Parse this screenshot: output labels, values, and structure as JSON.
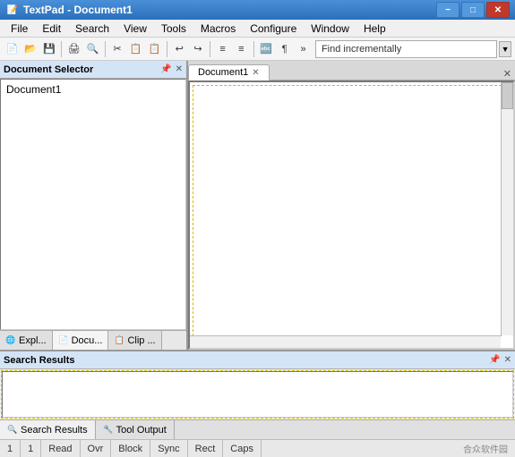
{
  "titlebar": {
    "title": "TextPad - Document1",
    "icon": "📝",
    "minimize": "−",
    "maximize": "□",
    "close": "✕"
  },
  "menubar": {
    "items": [
      "File",
      "Edit",
      "Search",
      "View",
      "Tools",
      "Macros",
      "Configure",
      "Window",
      "Help"
    ]
  },
  "toolbar": {
    "buttons": [
      "📄",
      "📂",
      "💾",
      "🖨",
      "🔍",
      "✂",
      "📋",
      "📋",
      "↩",
      "↪",
      "≡",
      "≡",
      "🔤",
      "¶",
      "»"
    ],
    "find_label": "Find incrementally"
  },
  "left_panel": {
    "title": "Document Selector",
    "tabs": [
      "Expl...",
      "Docu...",
      "Clip ..."
    ],
    "documents": [
      "Document1"
    ]
  },
  "right_panel": {
    "tabs": [
      "Document1"
    ],
    "close_label": "×"
  },
  "search_panel": {
    "title": "Search Results",
    "tabs": [
      "Search Results",
      "Tool Output"
    ]
  },
  "statusbar": {
    "line": "1",
    "col": "1",
    "mode_read": "Read",
    "mode_ovr": "Ovr",
    "mode_block": "Block",
    "mode_sync": "Sync",
    "mode_rect": "Rect",
    "mode_caps": "Caps",
    "watermark": "合众软件园"
  }
}
